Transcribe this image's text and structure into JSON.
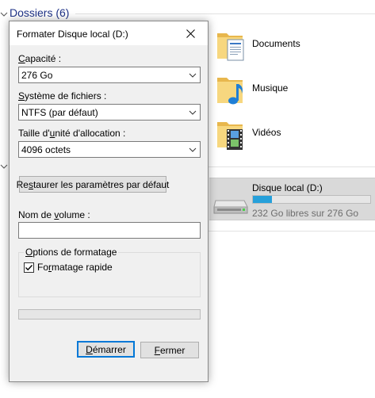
{
  "explorer": {
    "group_header": "Dossiers (6)",
    "folders": [
      {
        "name": "Documents",
        "icon": "documents-folder-icon"
      },
      {
        "name": "Musique",
        "icon": "music-folder-icon"
      },
      {
        "name": "Vidéos",
        "icon": "videos-folder-icon"
      }
    ],
    "drive": {
      "name": "Disque local (D:)",
      "free_text": "232 Go libres sur 276 Go",
      "used_fraction": 0.16,
      "icon": "hard-drive-icon",
      "bar_color": "#26a0da"
    }
  },
  "dialog": {
    "title": "Formater Disque local (D:)",
    "capacity": {
      "label": "Capacité :",
      "accesskey": "C",
      "value": "276 Go"
    },
    "filesystem": {
      "label": "Système de fichiers :",
      "accesskey": "S",
      "value": "NTFS (par défaut)"
    },
    "allocation": {
      "label": "Taille d'unité d'allocation :",
      "accesskey": "u",
      "value": "4096 octets"
    },
    "restore_button": {
      "label": "Restaurer les paramètres par défaut",
      "accesskey": "s"
    },
    "volume_name": {
      "label": "Nom de volume :",
      "accesskey": "v",
      "value": ""
    },
    "format_options": {
      "title": "Options de formatage",
      "accesskey": "O",
      "quick_format": {
        "label": "Formatage rapide",
        "accesskey": "r",
        "checked": true
      }
    },
    "progress": 0,
    "start_button": {
      "label": "Démarrer",
      "accesskey": "D"
    },
    "close_button": {
      "label": "Fermer",
      "accesskey": "F"
    }
  },
  "colors": {
    "accent": "#0078d7",
    "header_text": "#1e3287",
    "progress_fill": "#06b025"
  }
}
